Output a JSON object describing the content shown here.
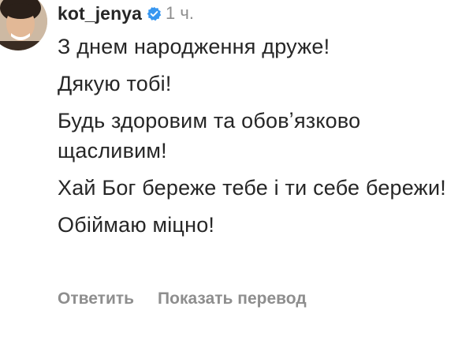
{
  "comment": {
    "username": "kot_jenya",
    "verified_icon": "verified-badge-icon",
    "time": "1 ч.",
    "lines": [
      "З днем народження друже!",
      "Дякую тобі!",
      "Будь здоровим та обовʼязково щасливим!",
      "Хай Бог береже тебе і ти себе бережи!",
      "Обіймаю міцно!"
    ],
    "actions": {
      "reply_label": "Ответить",
      "translate_label": "Показать перевод"
    }
  },
  "colors": {
    "text": "#262626",
    "secondary": "#8e8e8e",
    "verified": "#3897f0"
  }
}
